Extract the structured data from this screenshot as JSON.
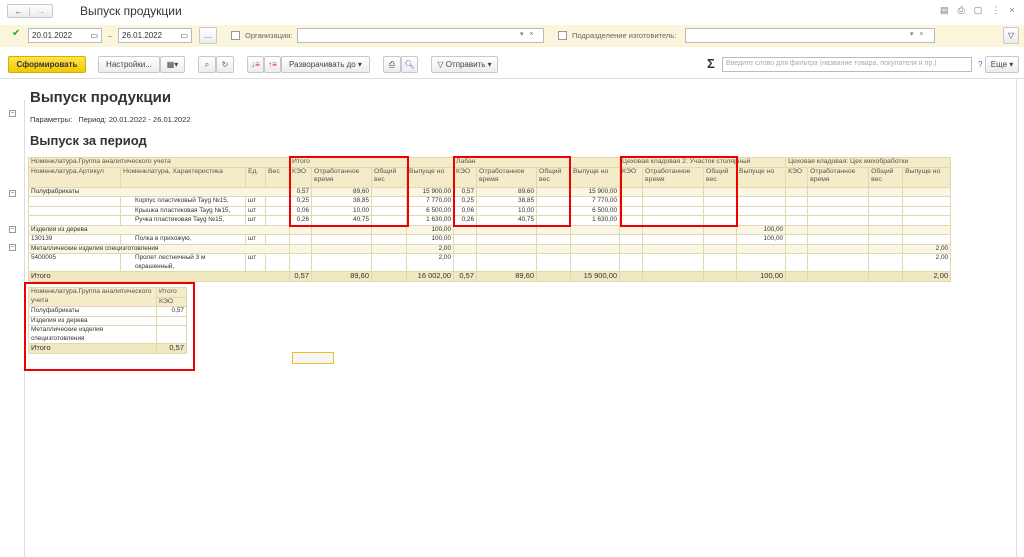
{
  "window": {
    "title": "Выпуск продукции",
    "back": "←",
    "forward": "→"
  },
  "filters": {
    "date_from": "20.01.2022",
    "dash": "–",
    "date_to": "26.01.2022",
    "ellipsis": "...",
    "org_label": "Организация:",
    "org_value": "",
    "dept_label": "Подразделение изготовитель:",
    "dept_value": ""
  },
  "toolbar": {
    "generate": "Сформировать",
    "settings": "Настройки...",
    "expand_to": "Разворачивать до",
    "send": "Отправить",
    "filter_placeholder": "Введите слово для фильтра (название товара, покупателя и пр.)",
    "help": "?",
    "more": "Еще",
    "sigma": "Σ"
  },
  "report": {
    "title": "Выпуск продукции",
    "params_label": "Параметры:",
    "params_value": "Период: 20.01.2022 - 26.01.2022",
    "subtitle": "Выпуск за период"
  },
  "table": {
    "group_header": "Номенклатура.Группа аналитического учета",
    "col_article": "Номенклатура.Артикул",
    "col_name": "Номенклатура, Характеристика",
    "col_unit": "Ед.",
    "col_weight": "Вес",
    "sections": [
      "Итого",
      "Лабан",
      "Цеховая кладовая 2: Участок столярный",
      "Цеховая кладовая: Цех мехобработки"
    ],
    "sub": [
      "КЭО",
      "Отработанное время",
      "Общий вес",
      "Выпуще но"
    ],
    "rows": [
      {
        "type": "g",
        "a": "Полуфабрикаты",
        "v": [
          "0,57",
          "89,60",
          "",
          "15 900,00",
          "0,57",
          "89,60",
          "",
          "15 900,00",
          "",
          "",
          "",
          "",
          "",
          "",
          "",
          ""
        ]
      },
      {
        "type": "d",
        "a": "",
        "n": "Корпус пластиковый Tayg №15,",
        "u": "шт",
        "v": [
          "0,25",
          "38,85",
          "",
          "7 770,00",
          "0,25",
          "38,85",
          "",
          "7 770,00",
          "",
          "",
          "",
          "",
          "",
          "",
          "",
          ""
        ]
      },
      {
        "type": "d",
        "a": "",
        "n": "Крышка пластиковая Tayg №15,",
        "u": "шт",
        "v": [
          "0,06",
          "10,00",
          "",
          "6 500,00",
          "0,06",
          "10,00",
          "",
          "6 500,00",
          "",
          "",
          "",
          "",
          "",
          "",
          "",
          ""
        ]
      },
      {
        "type": "d",
        "a": "",
        "n": "Ручка пластиковая Tayg №15,",
        "u": "шт",
        "v": [
          "0,26",
          "40,75",
          "",
          "1 630,00",
          "0,26",
          "40,75",
          "",
          "1 630,00",
          "",
          "",
          "",
          "",
          "",
          "",
          "",
          ""
        ]
      },
      {
        "type": "g",
        "a": "Изделия из дерева",
        "v": [
          "",
          "",
          "",
          "100,00",
          "",
          "",
          "",
          "",
          "",
          "",
          "",
          "100,00",
          "",
          "",
          "",
          ""
        ]
      },
      {
        "type": "d",
        "a": "130139",
        "n": "Полка в прихожую,",
        "u": "шт",
        "v": [
          "",
          "",
          "",
          "100,00",
          "",
          "",
          "",
          "",
          "",
          "",
          "",
          "100,00",
          "",
          "",
          "",
          ""
        ]
      },
      {
        "type": "g",
        "a": "Металлические изделия специзготовления",
        "v": [
          "",
          "",
          "",
          "2,00",
          "",
          "",
          "",
          "",
          "",
          "",
          "",
          "",
          "",
          "",
          "",
          "2,00"
        ]
      },
      {
        "type": "d",
        "a": "5400005",
        "n": "Пролет лестничный 3 м окрашенный,",
        "u": "шт",
        "v": [
          "",
          "",
          "",
          "2,00",
          "",
          "",
          "",
          "",
          "",
          "",
          "",
          "",
          "",
          "",
          "",
          "2,00"
        ]
      },
      {
        "type": "t",
        "a": "Итого",
        "v": [
          "0,57",
          "89,60",
          "",
          "16 002,00",
          "0,57",
          "89,60",
          "",
          "15 900,00",
          "",
          "",
          "",
          "100,00",
          "",
          "",
          "",
          "2,00"
        ]
      }
    ]
  },
  "summary": {
    "h1": "Номенклатура.Группа аналитического учета",
    "h2a": "Итого",
    "h2b": "КЭО",
    "rows": [
      {
        "n": "Полуфабрикаты",
        "v": "0,57"
      },
      {
        "n": "Изделия из дерева",
        "v": ""
      },
      {
        "n": "Металлические изделия специзготовления",
        "v": ""
      }
    ],
    "total_label": "Итого",
    "total": "0,57"
  }
}
